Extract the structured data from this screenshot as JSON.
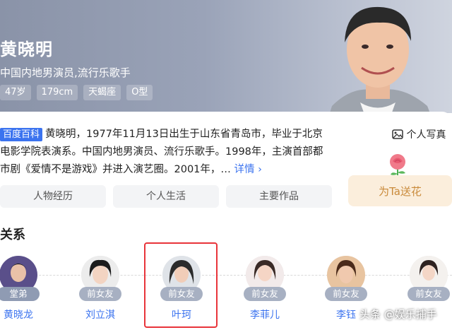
{
  "hero": {
    "name": "黄晓明",
    "description": "中国内地男演员,流行乐歌手",
    "tags": [
      "47岁",
      "179cm",
      "天蝎座",
      "O型"
    ],
    "photo_button": "个人写真"
  },
  "intro": {
    "source_badge": "百度百科",
    "text": "黄晓明，1977年11月13日出生于山东省青岛市，毕业于北京电影学院表演系。中国内地男演员、流行乐歌手。1998年，主演首部都市剧《爱情不是游戏》并进入演艺圈。2001年，…",
    "more_label": "详情 ›"
  },
  "tabs": [
    "人物经历",
    "个人生活",
    "主要作品"
  ],
  "flower": {
    "label": "为Ta送花",
    "icon": "rose-icon"
  },
  "relations": {
    "title": "关系",
    "people": [
      {
        "relation": "堂弟",
        "name": "黄晓龙"
      },
      {
        "relation": "前女友",
        "name": "刘立淇"
      },
      {
        "relation": "前女友",
        "name": "叶珂"
      },
      {
        "relation": "前女友",
        "name": "李菲儿"
      },
      {
        "relation": "前女友",
        "name": "李钰"
      },
      {
        "relation": "前女友",
        "name": ""
      }
    ]
  },
  "watermark": "头条 @娱乐捕手",
  "colors": {
    "accent": "#3b73ef",
    "highlight": "#e8343a",
    "badge": "#a7b0c2"
  }
}
